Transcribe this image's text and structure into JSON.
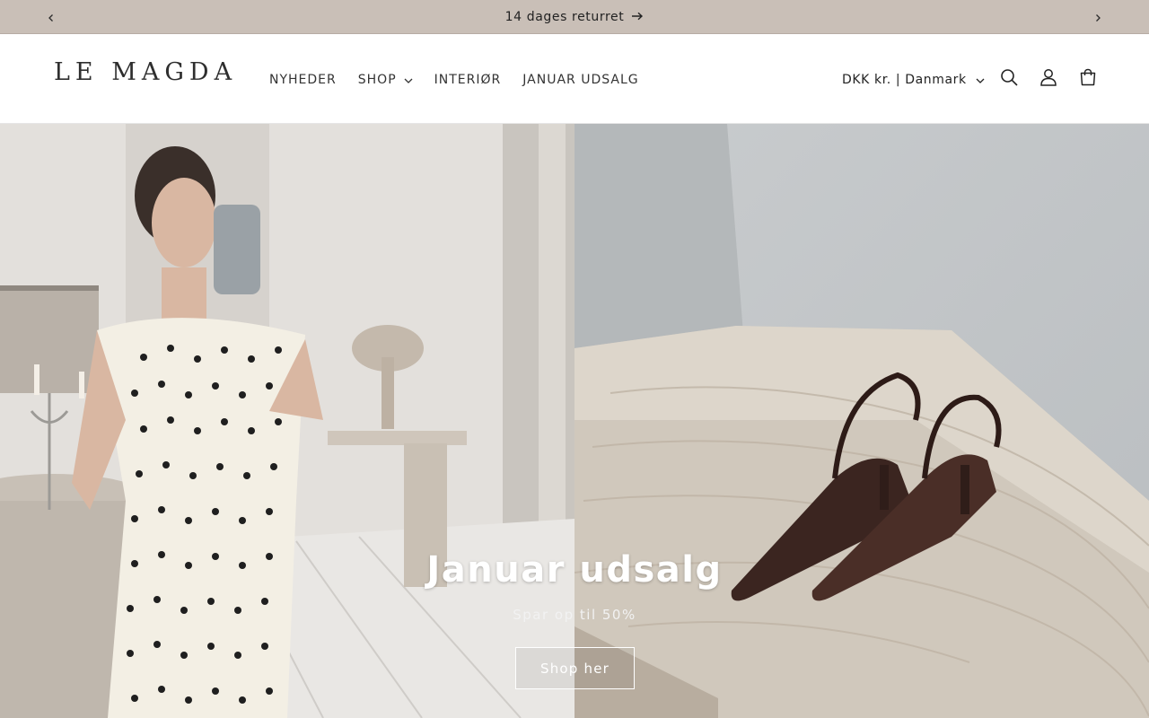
{
  "announcement": {
    "text": "14 dages returret",
    "prev_icon": "chevron-left-icon",
    "next_icon": "chevron-right-icon",
    "arrow_icon": "arrow-right-icon",
    "background": "#c9bfb7"
  },
  "header": {
    "logo": "LE MAGDA",
    "nav": [
      {
        "label": "NYHEDER",
        "has_dropdown": false
      },
      {
        "label": "SHOP",
        "has_dropdown": true
      },
      {
        "label": "INTERIØR",
        "has_dropdown": false
      },
      {
        "label": "JANUAR UDSALG",
        "has_dropdown": false
      }
    ],
    "locale": "DKK kr. | Danmark",
    "icons": [
      "search-icon",
      "account-icon",
      "cart-icon"
    ]
  },
  "hero": {
    "title": "Januar udsalg",
    "subtitle": "Spar op til 50%",
    "button_label": "Shop her"
  }
}
